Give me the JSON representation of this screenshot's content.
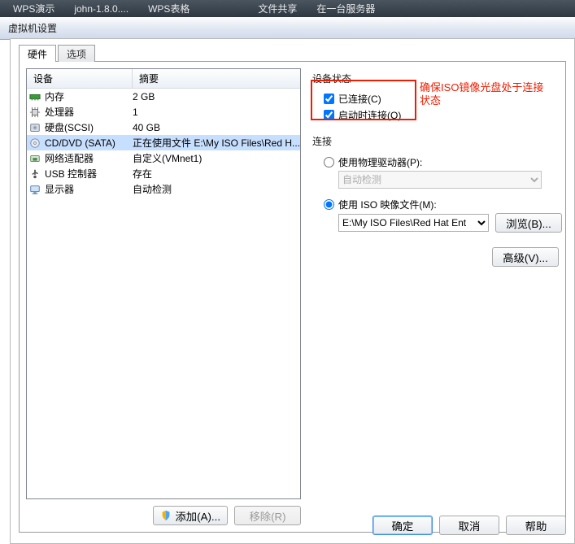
{
  "taskbar": {
    "items": [
      "WPS演示",
      "john-1.8.0....",
      "WPS表格",
      "文件共享",
      "在一台服务器"
    ]
  },
  "window": {
    "title": "虚拟机设置"
  },
  "tabs": {
    "hardware": "硬件",
    "options": "选项"
  },
  "columns": {
    "device": "设备",
    "summary": "摘要"
  },
  "devices": [
    {
      "icon": "memory-icon",
      "name": "内存",
      "summary": "2 GB"
    },
    {
      "icon": "cpu-icon",
      "name": "处理器",
      "summary": "1"
    },
    {
      "icon": "hdd-icon",
      "name": "硬盘(SCSI)",
      "summary": "40 GB"
    },
    {
      "icon": "cd-icon",
      "name": "CD/DVD (SATA)",
      "summary": "正在使用文件 E:\\My ISO Files\\Red H..."
    },
    {
      "icon": "nic-icon",
      "name": "网络适配器",
      "summary": "自定义(VMnet1)"
    },
    {
      "icon": "usb-icon",
      "name": "USB 控制器",
      "summary": "存在"
    },
    {
      "icon": "display-icon",
      "name": "显示器",
      "summary": "自动检测"
    }
  ],
  "leftButtons": {
    "add": "添加(A)...",
    "remove": "移除(R)"
  },
  "right": {
    "statusTitle": "设备状态",
    "connected": "已连接(C)",
    "connectAtPowerOn": "启动时连接(O)",
    "connectionTitle": "连接",
    "usePhysical": "使用物理驱动器(P):",
    "autoDetect": "自动检测",
    "useISO": "使用 ISO 映像文件(M):",
    "isoPath": "E:\\My ISO Files\\Red Hat Ent",
    "browse": "浏览(B)...",
    "advanced": "高级(V)..."
  },
  "annotation": {
    "line1": "确保ISO镜像光盘处于连接",
    "line2": "状态"
  },
  "footer": {
    "ok": "确定",
    "cancel": "取消",
    "help": "帮助"
  }
}
